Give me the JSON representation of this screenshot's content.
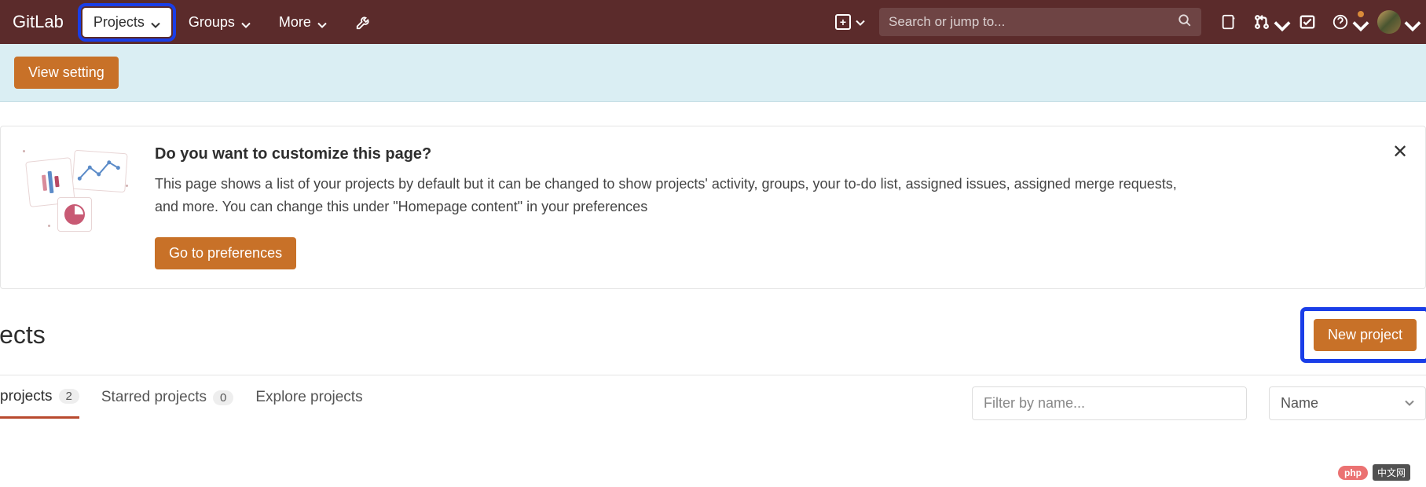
{
  "brand": "GitLab",
  "nav": {
    "projects": "Projects",
    "groups": "Groups",
    "more": "More"
  },
  "search": {
    "placeholder": "Search or jump to..."
  },
  "alert": {
    "view_setting": "View setting"
  },
  "customize": {
    "title": "Do you want to customize this page?",
    "description": "This page shows a list of your projects by default but it can be changed to show projects' activity, groups, your to-do list, assigned issues, assigned merge requests, and more. You can change this under \"Homepage content\" in your preferences",
    "button": "Go to preferences"
  },
  "projects": {
    "title": "jects",
    "new_button": "New project"
  },
  "tabs": {
    "your": {
      "label": "projects",
      "count": "2"
    },
    "starred": {
      "label": "Starred projects",
      "count": "0"
    },
    "explore": {
      "label": "Explore projects"
    }
  },
  "filter": {
    "placeholder": "Filter by name..."
  },
  "sort": {
    "selected": "Name"
  },
  "watermark": {
    "pill": "php",
    "box": "中文网"
  }
}
